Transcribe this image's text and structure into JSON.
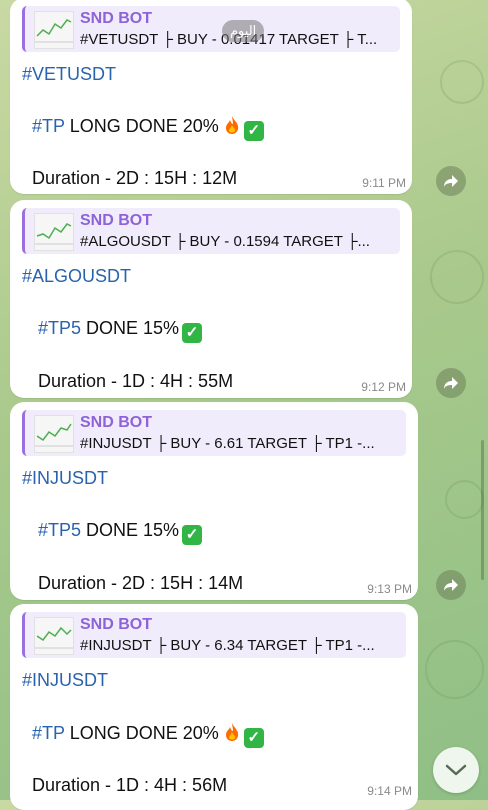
{
  "date_pill": "اليوم",
  "messages": [
    {
      "reply_name": "SND BOT",
      "reply_text": "#VETUSDT ├ BUY - 0.01417 TARGET ├ T...",
      "hashtag": "#VETUSDT",
      "tp_tag": "#TP",
      "tp_text": " LONG DONE 20%",
      "emojis": [
        "fire-icon",
        "check-mark-icon"
      ],
      "duration": "Duration - 2D : 15H : 12M",
      "time": "9:11 PM"
    },
    {
      "reply_name": "SND BOT",
      "reply_text": "#ALGOUSDT ├ BUY - 0.1594 TARGET ├...",
      "hashtag": "#ALGOUSDT",
      "tp_tag": "#TP5",
      "tp_text": " DONE 15%",
      "emojis": [
        "check-mark-icon"
      ],
      "duration": "Duration - 1D : 4H : 55M",
      "time": "9:12 PM"
    },
    {
      "reply_name": "SND BOT",
      "reply_text": "#INJUSDT ├ BUY - 6.61 TARGET ├ TP1 -...",
      "hashtag": "#INJUSDT",
      "tp_tag": "#TP5",
      "tp_text": " DONE 15%",
      "emojis": [
        "check-mark-icon"
      ],
      "duration": "Duration - 2D : 15H : 14M",
      "time": "9:13 PM"
    },
    {
      "reply_name": "SND BOT",
      "reply_text": "#INJUSDT ├ BUY - 6.34 TARGET ├ TP1 -...",
      "hashtag": "#INJUSDT",
      "tp_tag": "#TP",
      "tp_text": " LONG DONE 20%",
      "emojis": [
        "fire-icon",
        "check-mark-icon"
      ],
      "duration": "Duration - 1D : 4H : 56M",
      "time": "9:14 PM"
    }
  ],
  "colors": {
    "hashtag": "#2a63ad",
    "reply_name": "#8e63d8",
    "reply_bg": "#f1ecfb",
    "check_bg": "#31b545"
  }
}
